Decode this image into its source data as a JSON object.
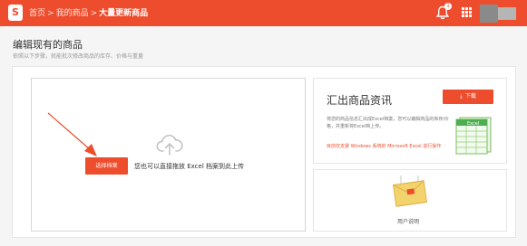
{
  "brand": {
    "logo_letter": "S",
    "accent": "#ee4d2d"
  },
  "breadcrumb": {
    "home": "首页",
    "my_products": "我的商品",
    "current": "大量更新商品",
    "separator": ">"
  },
  "header": {
    "notification_count": "1",
    "icons": [
      "bell-icon",
      "apps-grid-icon",
      "avatar"
    ]
  },
  "page": {
    "title": "编辑现有的商品",
    "subtitle": "依照以下步骤，就能批次修改商品的库存、价格与重量"
  },
  "upload": {
    "button_label": "选择档案",
    "hint": "您也可以直接拖放 Excel 档案到此上传",
    "icon": "upload-cloud-icon"
  },
  "export": {
    "title": "汇出商品资讯",
    "download_label": "下载",
    "description": "将您的商品信息汇出成Excel档案，您可以编辑商品的库存/价格，并重新将Excel档上传。",
    "warning": "目前仅支援 Windows 系统的 Microsoft Excel 进行操作",
    "illustration_label": "Excel"
  },
  "guide": {
    "label": "用户说明"
  }
}
